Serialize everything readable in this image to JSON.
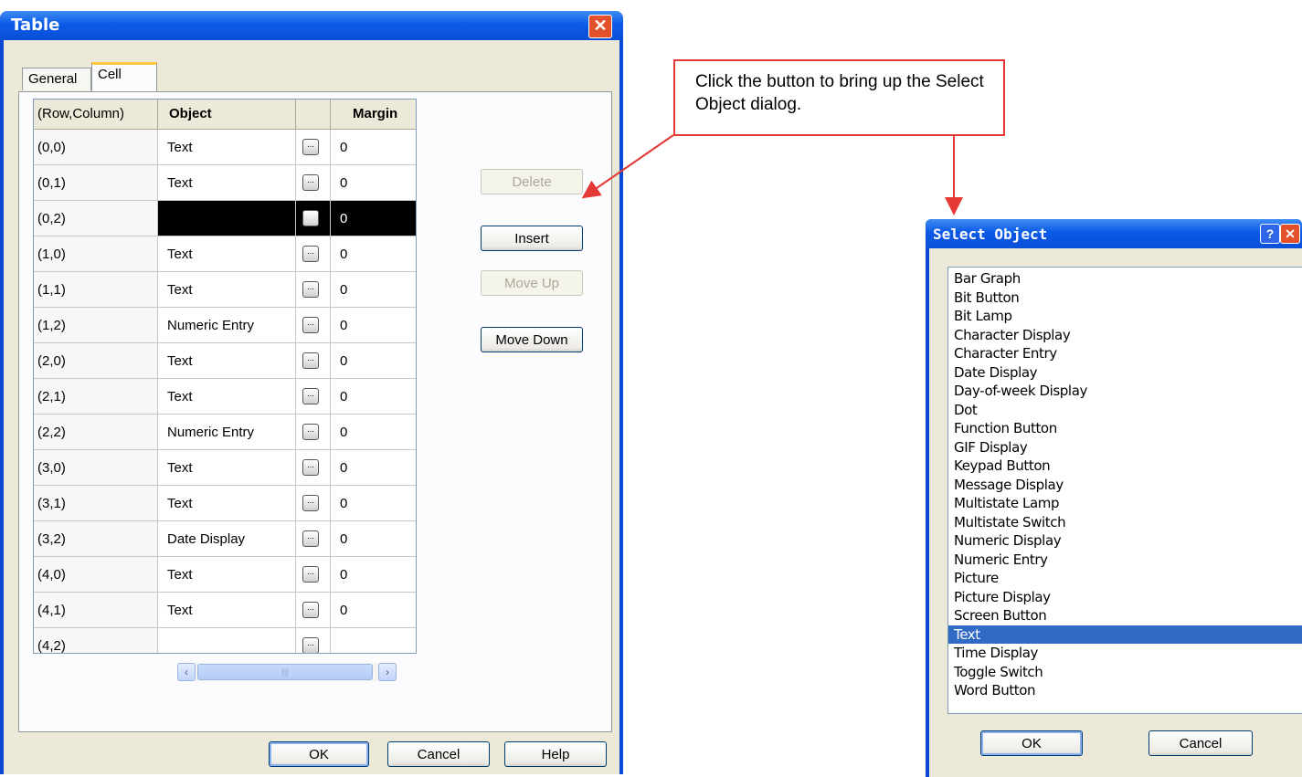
{
  "table_dialog": {
    "title": "Table",
    "tabs": [
      "General",
      "Cell"
    ],
    "active_tab": "Cell",
    "columns": [
      "(Row,Column)",
      "Object",
      "",
      "Margin"
    ],
    "rows": [
      {
        "rc": "(0,0)",
        "object": "Text",
        "margin": "0"
      },
      {
        "rc": "(0,1)",
        "object": "Text",
        "margin": "0"
      },
      {
        "rc": "(0,2)",
        "object": "",
        "margin": "0",
        "selected": true
      },
      {
        "rc": "(1,0)",
        "object": "Text",
        "margin": "0"
      },
      {
        "rc": "(1,1)",
        "object": "Text",
        "margin": "0"
      },
      {
        "rc": "(1,2)",
        "object": "Numeric Entry",
        "margin": "0"
      },
      {
        "rc": "(2,0)",
        "object": "Text",
        "margin": "0"
      },
      {
        "rc": "(2,1)",
        "object": "Text",
        "margin": "0"
      },
      {
        "rc": "(2,2)",
        "object": "Numeric Entry",
        "margin": "0"
      },
      {
        "rc": "(3,0)",
        "object": "Text",
        "margin": "0"
      },
      {
        "rc": "(3,1)",
        "object": "Text",
        "margin": "0"
      },
      {
        "rc": "(3,2)",
        "object": "Date Display",
        "margin": "0"
      },
      {
        "rc": "(4,0)",
        "object": "Text",
        "margin": "0"
      },
      {
        "rc": "(4,1)",
        "object": "Text",
        "margin": "0"
      },
      {
        "rc": "(4,2)",
        "object": "",
        "margin": ""
      }
    ],
    "side_buttons": {
      "delete": "Delete",
      "insert": "Insert",
      "move_up": "Move Up",
      "move_down": "Move Down"
    },
    "footer_buttons": {
      "ok": "OK",
      "cancel": "Cancel",
      "help": "Help"
    },
    "close_glyph": "✕"
  },
  "callout": {
    "text": "Click the button to bring up the Select Object dialog.",
    "color": "#e53935"
  },
  "select_dialog": {
    "title": "Select Object",
    "help_glyph": "?",
    "close_glyph": "✕",
    "items": [
      "Bar Graph",
      "Bit Button",
      "Bit Lamp",
      "Character Display",
      "Character Entry",
      "Date Display",
      "Day-of-week Display",
      "Dot",
      "Function Button",
      "GIF Display",
      "Keypad Button",
      "Message Display",
      "Multistate Lamp",
      "Multistate Switch",
      "Numeric Display",
      "Numeric Entry",
      "Picture",
      "Picture Display",
      "Screen Button",
      "Text",
      "Time Display",
      "Toggle Switch",
      "Word Button"
    ],
    "selected_item": "Text",
    "buttons": {
      "ok": "OK",
      "cancel": "Cancel"
    }
  },
  "colors": {
    "titlebar": "#0a4fd7",
    "face": "#ece9d8",
    "selection": "#316ac5"
  }
}
